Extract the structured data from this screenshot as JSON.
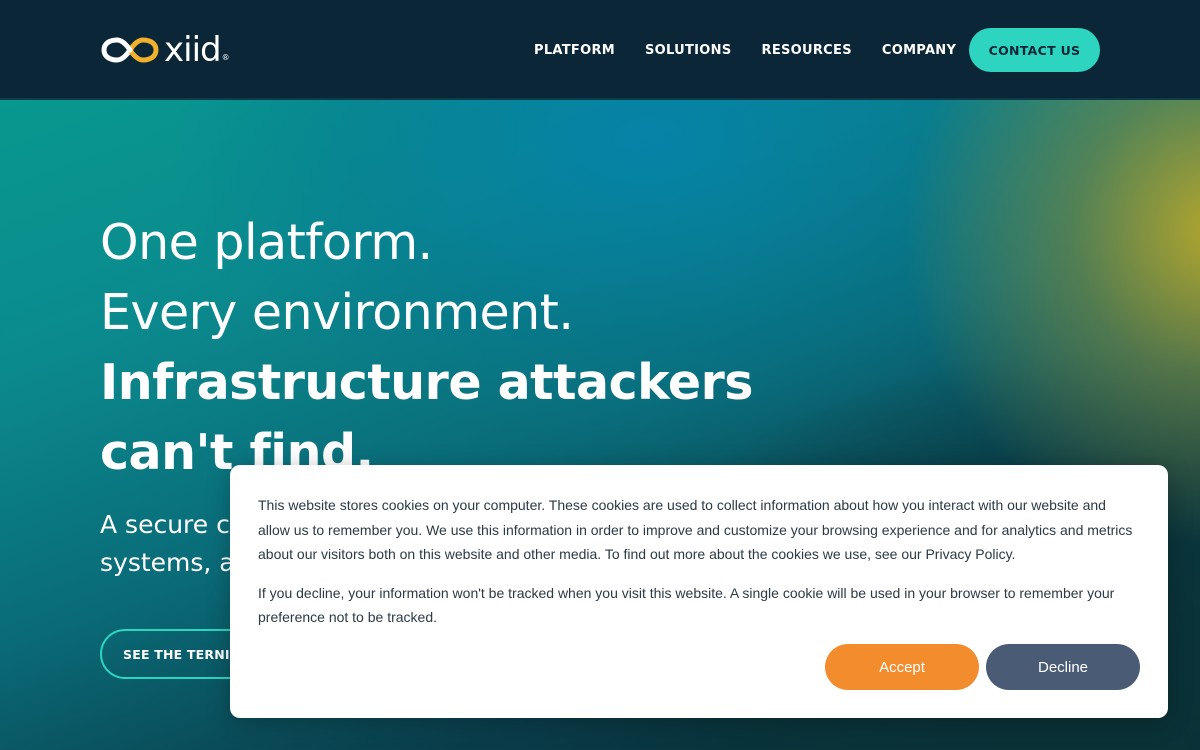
{
  "header": {
    "logo_text": "xiid",
    "logo_reg": "®",
    "nav": [
      "PLATFORM",
      "SOLUTIONS",
      "RESOURCES",
      "COMPANY"
    ],
    "contact_label": "CONTACT US"
  },
  "hero": {
    "line1": "One platform.",
    "line2": "Every environment.",
    "line3": "Infrastructure attackers",
    "line4": "can't find.",
    "sub_line1": "A secure c",
    "sub_line2": "systems, a",
    "cta_label": "SEE THE TERNIIO"
  },
  "cookie": {
    "para1": "This website stores cookies on your computer. These cookies are used to collect information about how you interact with our website and allow us to remember you. We use this information in order to improve and customize your browsing experience and for analytics and metrics about our visitors both on this website and other media. To find out more about the cookies we use, see our Privacy Policy.",
    "para2": "If you decline, your information won't be tracked when you visit this website. A single cookie will be used in your browser to remember your preference not to be tracked.",
    "accept_label": "Accept",
    "decline_label": "Decline"
  },
  "colors": {
    "header_bg": "#0b2636",
    "accent_teal": "#2dd4bf",
    "accept_orange": "#f28c2c",
    "decline_slate": "#4a5b75",
    "logo_gold": "#f2b02c"
  },
  "icons": {
    "logo": "infinity-link-icon"
  }
}
